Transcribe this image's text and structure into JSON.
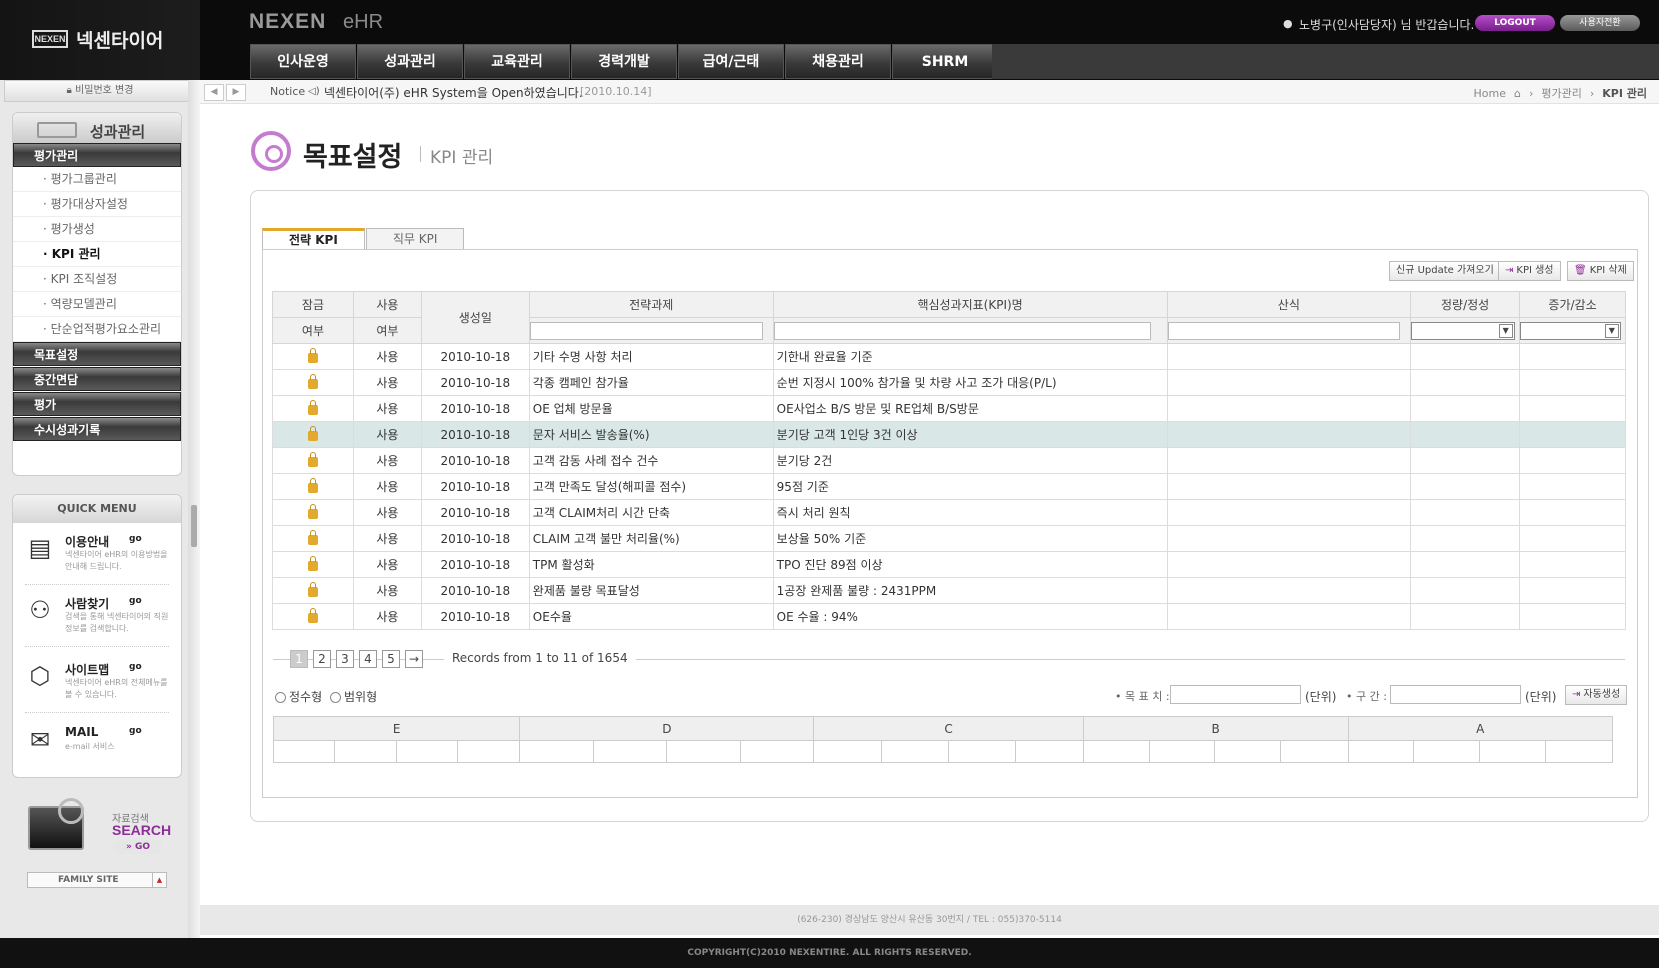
{
  "header": {
    "logo_mark": "NEXEN",
    "logo_text": "넥센타이어",
    "brand": "NEXEN",
    "brand_sub": "eHR",
    "greeting": "노병구(인사담당자) 님 반갑습니다.",
    "logout_label": "LOGOUT",
    "switch_user_label": "사용자전환",
    "nav": [
      "인사운영",
      "성과관리",
      "교육관리",
      "경력개발",
      "급여/근태",
      "채용관리",
      "SHRM"
    ]
  },
  "subbar": {
    "notice_label": "Notice",
    "notice_text": "넥센타이어(주) eHR System을 Open하였습니다.",
    "notice_date": "[2010.10.14]",
    "breadcrumb": [
      "Home",
      "평가관리",
      "KPI 관리"
    ]
  },
  "sidebar": {
    "password_change": "비밀번호 변경",
    "menu_title": "성과관리",
    "groups": [
      "평가관리",
      "목표설정",
      "중간면담",
      "평가",
      "수시성과기록"
    ],
    "sub_items": [
      "평가그룹관리",
      "평가대상자설정",
      "평가생성",
      "KPI 관리",
      "KPI 조직설정",
      "역량모델관리",
      "단순업적평가요소관리"
    ],
    "quick_menu_title": "QUICK MENU",
    "quick_items": [
      {
        "title": "이용안내",
        "go": "go",
        "desc": "넥센타이어 eHR의 이용방법을 안내해 드립니다."
      },
      {
        "title": "사람찾기",
        "go": "go",
        "desc": "검색을 통해 넥센타이어의 직원정보를 검색합니다."
      },
      {
        "title": "사이트맵",
        "go": "go",
        "desc": "넥센타이어 eHR의 전체메뉴를 볼 수 있습니다."
      },
      {
        "title": "MAIL",
        "go": "go",
        "desc": "e-mail 서비스"
      }
    ],
    "search_sub": "자료검색",
    "search_label": "SEARCH",
    "search_go": "» GO",
    "family_site": "FAMILY SITE"
  },
  "main": {
    "title": "목표설정",
    "subtitle": "KPI 관리",
    "tabs": [
      "전략 KPI",
      "직무 KPI"
    ],
    "toolbar": [
      "신규 Update 가져오기",
      "KPI 생성",
      "KPI 삭제"
    ],
    "columns": {
      "lock": [
        "잠금",
        "여부"
      ],
      "use": [
        "사용",
        "여부"
      ],
      "created": "생성일",
      "task": "전략과제",
      "kpi": "핵심성과지표(KPI)명",
      "formula": "산식",
      "type": "정량/정성",
      "trend": "증가/감소"
    },
    "rows": [
      {
        "use": "사용",
        "date": "2010-10-18",
        "task": "기타 수명 사항 처리",
        "kpi": "기한내 완료율 기준"
      },
      {
        "use": "사용",
        "date": "2010-10-18",
        "task": "각종 캠페인 참가율",
        "kpi": "순번 지정시 100% 참가율 및 차량 사고 조가 대응(P/L)"
      },
      {
        "use": "사용",
        "date": "2010-10-18",
        "task": "OE 업체 방문율",
        "kpi": "OE사업소 B/S 방문 및 RE업체 B/S방문"
      },
      {
        "use": "사용",
        "date": "2010-10-18",
        "task": "문자 서비스 발송율(%)",
        "kpi": "분기당 고객 1인당 3건 이상"
      },
      {
        "use": "사용",
        "date": "2010-10-18",
        "task": "고객 감동 사례 접수 건수",
        "kpi": "분기당 2건"
      },
      {
        "use": "사용",
        "date": "2010-10-18",
        "task": "고객 만족도 달성(해피콜 점수)",
        "kpi": "95점 기준"
      },
      {
        "use": "사용",
        "date": "2010-10-18",
        "task": "고객 CLAIM처리 시간 단축",
        "kpi": "즉시 처리 원칙"
      },
      {
        "use": "사용",
        "date": "2010-10-18",
        "task": "CLAIM 고객 불만 처리율(%)",
        "kpi": "보상율 50% 기준"
      },
      {
        "use": "사용",
        "date": "2010-10-18",
        "task": "TPM 활성화",
        "kpi": "TPO 진단 89점 이상"
      },
      {
        "use": "사용",
        "date": "2010-10-18",
        "task": "완제품 불량 목표달성",
        "kpi": "1공장 완제품 불량 : 2431PPM"
      },
      {
        "use": "사용",
        "date": "2010-10-18",
        "task": "OE수율",
        "kpi": "OE 수율 : 94%"
      }
    ],
    "pager": {
      "pages": [
        "1",
        "2",
        "3",
        "4",
        "5"
      ],
      "next": "→",
      "records": "Records from 1 to 11 of 1654"
    },
    "radio": [
      "정수형",
      "범위형"
    ],
    "target_label": "• 목 표 치 :",
    "range_label": "• 구 간 :",
    "unit": "(단위)",
    "auto_btn": "자동생성",
    "grades": [
      "E",
      "D",
      "C",
      "B",
      "A"
    ]
  },
  "footer": {
    "address": "(626-230) 경상남도 양산시 유산동 30번지    /    TEL : 055)370-5114",
    "copyright": "COPYRIGHT(C)2010 NEXENTIRE. ALL RIGHTS RESERVED."
  }
}
